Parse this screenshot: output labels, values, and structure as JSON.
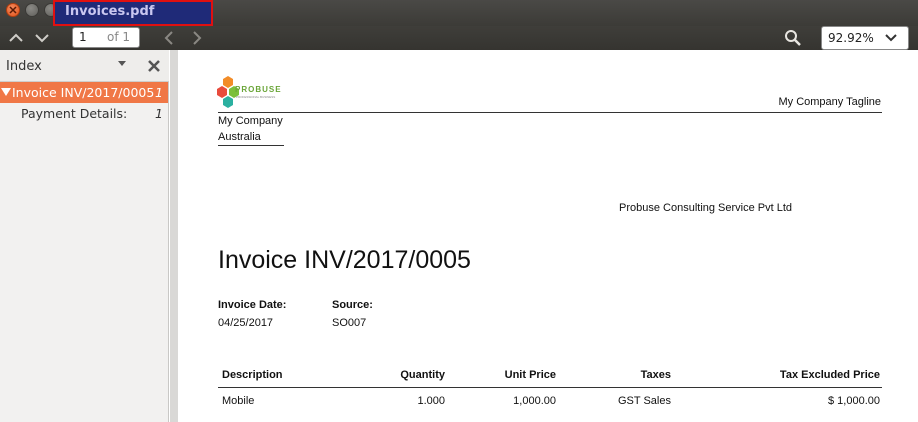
{
  "window": {
    "title": "Invoices.pdf"
  },
  "toolbar": {
    "current_page": "1",
    "page_total": "of 1",
    "zoom": "92.92%"
  },
  "sidebar": {
    "header": "Index",
    "items": [
      {
        "label": "Invoice INV/2017/0005",
        "page": "1",
        "selected": true
      },
      {
        "label": "Payment Details:",
        "page": "1",
        "selected": false
      }
    ]
  },
  "document": {
    "logo_text": "PROBUSE",
    "logo_subtext": "PROFESSIONAL BUSINESS",
    "company_tagline": "My Company Tagline",
    "company_name": "My Company",
    "company_country": "Australia",
    "partner_name": "Probuse Consulting Service Pvt Ltd",
    "invoice_title": "Invoice INV/2017/0005",
    "invoice_date_label": "Invoice Date:",
    "invoice_date": "04/25/2017",
    "source_label": "Source:",
    "source": "SO007",
    "table": {
      "headers": [
        "Description",
        "Quantity",
        "Unit Price",
        "Taxes",
        "Tax Excluded Price"
      ],
      "rows": [
        [
          "Mobile",
          "1.000",
          "1,000.00",
          "GST Sales",
          "$ 1,000.00"
        ]
      ]
    }
  },
  "colors": {
    "selection": "#f07746",
    "title_highlight": "#1f2a78",
    "title_border": "#e01010"
  }
}
